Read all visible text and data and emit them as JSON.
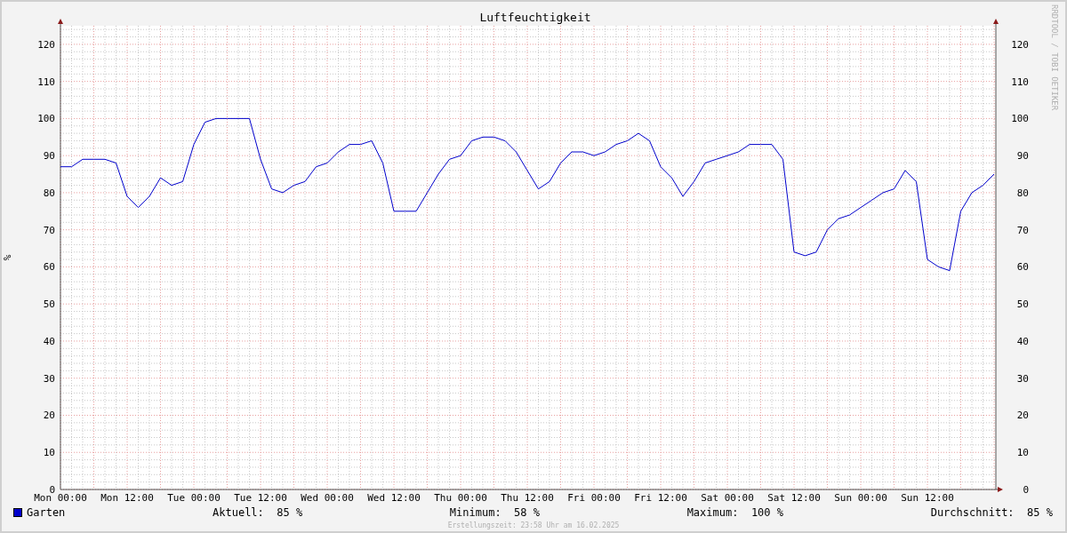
{
  "graph": {
    "watermark": "RRDTOOL / TOBI OETIKER",
    "right_axis_labels": [
      "120",
      "110",
      "100",
      "90",
      "80",
      "70",
      "60",
      "50",
      "40",
      "30",
      "20",
      "10",
      "0"
    ],
    "chart_data": {
      "type": "line",
      "title": "Luftfeuchtigkeit",
      "ylabel": "%",
      "ylim": [
        0,
        125
      ],
      "grid": true,
      "yticks": [
        0,
        10,
        20,
        30,
        40,
        50,
        60,
        70,
        80,
        90,
        100,
        110,
        120
      ],
      "categories": [
        "Mon 00:00",
        null,
        null,
        null,
        null,
        null,
        "Mon 12:00",
        null,
        null,
        null,
        null,
        null,
        "Tue 00:00",
        null,
        null,
        null,
        null,
        null,
        "Tue 12:00",
        null,
        null,
        null,
        null,
        null,
        "Wed 00:00",
        null,
        null,
        null,
        null,
        null,
        "Wed 12:00",
        null,
        null,
        null,
        null,
        null,
        "Thu 00:00",
        null,
        null,
        null,
        null,
        null,
        "Thu 12:00",
        null,
        null,
        null,
        null,
        null,
        "Fri 00:00",
        null,
        null,
        null,
        null,
        null,
        "Fri 12:00",
        null,
        null,
        null,
        null,
        null,
        "Sat 00:00",
        null,
        null,
        null,
        null,
        null,
        "Sat 12:00",
        null,
        null,
        null,
        null,
        null,
        "Sun 00:00",
        null,
        null,
        null,
        null,
        null,
        "Sun 12:00",
        null,
        null,
        null,
        null,
        null,
        null
      ],
      "series": [
        {
          "name": "Garten",
          "color": "#0000cc",
          "values": [
            87,
            87,
            89,
            89,
            89,
            88,
            79,
            76,
            79,
            84,
            82,
            83,
            93,
            99,
            100,
            100,
            100,
            100,
            89,
            81,
            80,
            82,
            83,
            87,
            88,
            91,
            93,
            93,
            94,
            88,
            75,
            75,
            75,
            80,
            85,
            89,
            90,
            94,
            95,
            95,
            94,
            91,
            86,
            81,
            83,
            88,
            91,
            91,
            90,
            91,
            93,
            94,
            96,
            94,
            87,
            84,
            79,
            83,
            88,
            89,
            90,
            91,
            93,
            93,
            93,
            89,
            64,
            63,
            64,
            70,
            73,
            74,
            76,
            78,
            80,
            81,
            86,
            83,
            62,
            60,
            59,
            75,
            80,
            82,
            85
          ]
        }
      ]
    }
  },
  "legend": {
    "stats": [
      {
        "label": "Aktuell:",
        "value": "85 %"
      },
      {
        "label": "Minimum:",
        "value": "58 %"
      },
      {
        "label": "Maximum:",
        "value": "100 %"
      },
      {
        "label": "Durchschnitt:",
        "value": "85 %"
      }
    ]
  },
  "footer": "Erstellungszeit: 23:58 Uhr am 16.02.2025"
}
